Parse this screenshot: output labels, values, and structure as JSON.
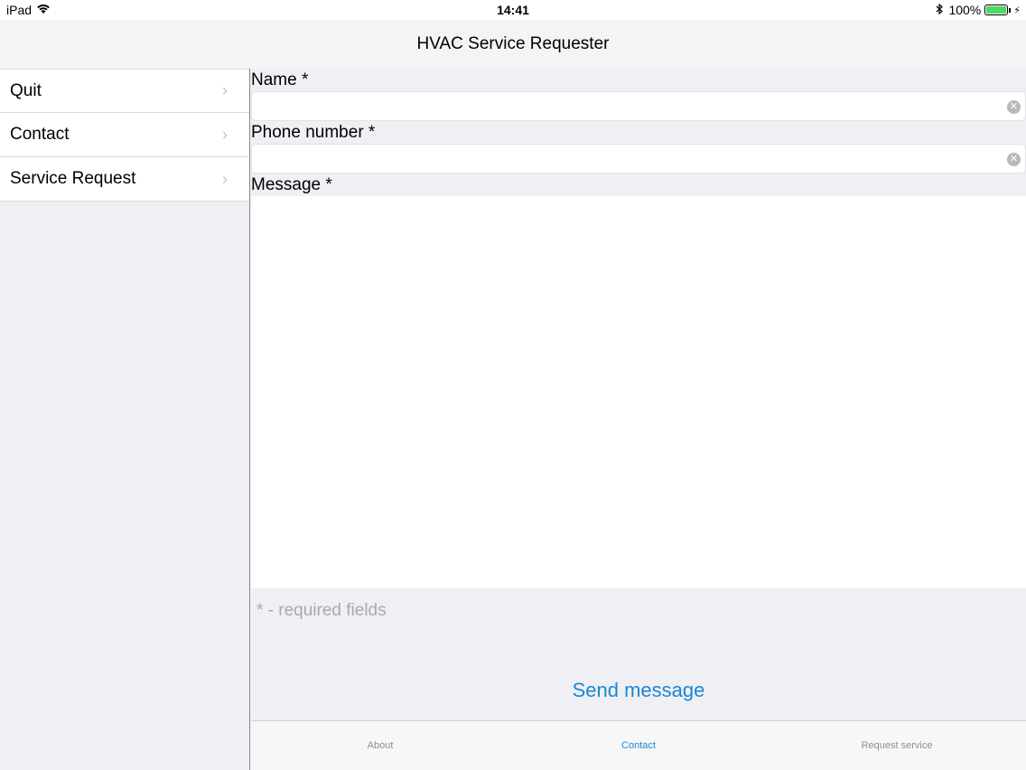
{
  "status_bar": {
    "carrier": "iPad",
    "time": "14:41",
    "battery": "100%",
    "battery_level": 1.0
  },
  "nav": {
    "title": "HVAC Service Requester"
  },
  "sidebar": {
    "items": [
      {
        "label": "Quit"
      },
      {
        "label": "Contact"
      },
      {
        "label": "Service Request"
      }
    ]
  },
  "form": {
    "name_label": "Name *",
    "name_value": "",
    "phone_label": "Phone number *",
    "phone_value": "",
    "message_label": "Message *",
    "message_value": "",
    "required_note": "* - required fields",
    "send_label": "Send message"
  },
  "tabs": [
    {
      "label": "About",
      "active": false
    },
    {
      "label": "Contact",
      "active": true
    },
    {
      "label": "Request service",
      "active": false
    }
  ],
  "colors": {
    "accent": "#1b86d4",
    "battery": "#4cd964"
  }
}
